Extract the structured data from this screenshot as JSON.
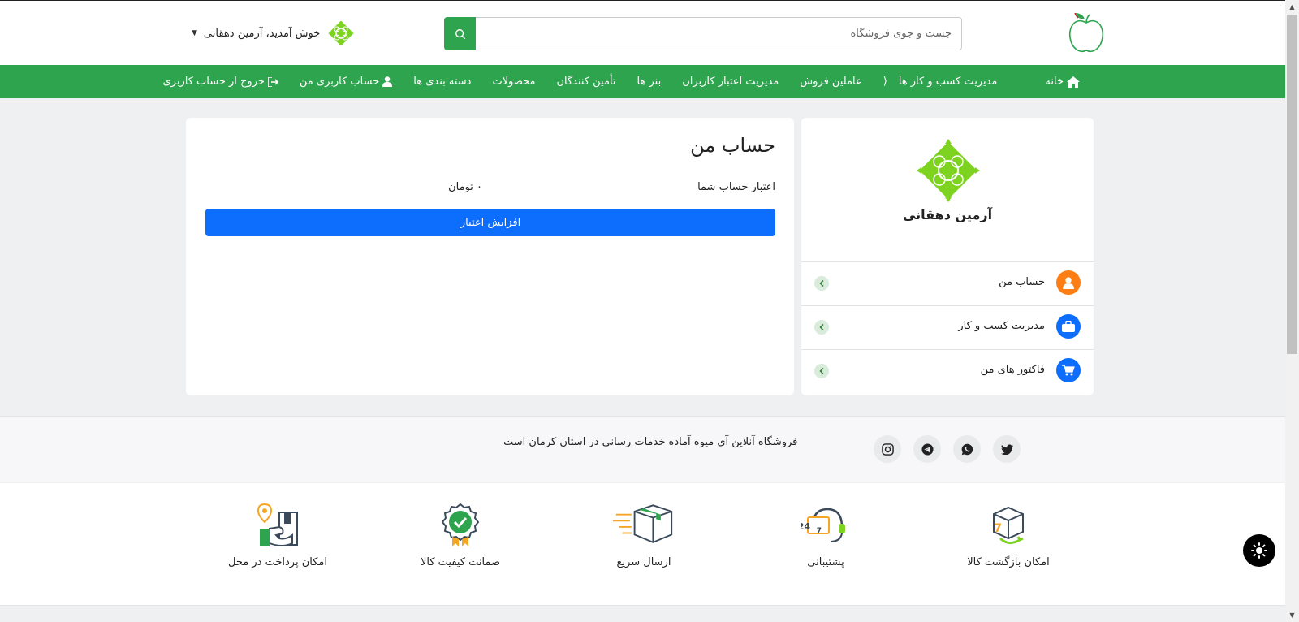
{
  "header": {
    "search_placeholder": "جست و جوی فروشگاه",
    "welcome_text": "خوش آمدید، آرمین دهقانی"
  },
  "nav": {
    "items": [
      {
        "label": "خانه",
        "icon": "home-icon"
      },
      {
        "label": "مدیریت کسب و کار ها",
        "icon": "chevron-down-icon"
      },
      {
        "label": "عاملین فروش"
      },
      {
        "label": "مدیریت اعتبار کاربران"
      },
      {
        "label": "بنر ها"
      },
      {
        "label": "تأمین کنندگان"
      },
      {
        "label": "محصولات"
      },
      {
        "label": "دسته بندی ها"
      },
      {
        "label": "حساب کاربری من",
        "icon": "user-icon"
      },
      {
        "label": "خروج از حساب کاربری",
        "icon": "logout-icon"
      }
    ]
  },
  "sidebar": {
    "user_name": "آرمین دهقانی",
    "menu": [
      {
        "label": "حساب من",
        "icon": "user-icon",
        "color": "#fd7e14"
      },
      {
        "label": "مدیریت کسب و کار",
        "icon": "briefcase-icon",
        "color": "#0d6efd"
      },
      {
        "label": "فاکتور های من",
        "icon": "cart-icon",
        "color": "#0d6efd"
      }
    ]
  },
  "account": {
    "title": "حساب من",
    "credit_label": "اعتبار حساب شما",
    "credit_value": "۰ تومان",
    "increase_button": "افزایش اعتبار"
  },
  "footer": {
    "tagline": "فروشگاه آنلاین آی میوه آماده خدمات رسانی در استان کرمان است",
    "socials": [
      "twitter-icon",
      "whatsapp-icon",
      "telegram-icon",
      "instagram-icon"
    ],
    "features": [
      {
        "label": "امکان بازگشت کالا",
        "icon": "return-box-icon"
      },
      {
        "label": "پشتیبانی",
        "icon": "support-24-7-icon"
      },
      {
        "label": "ارسال سریع",
        "icon": "fast-delivery-icon"
      },
      {
        "label": "ضمانت کیفیت کالا",
        "icon": "quality-badge-icon"
      },
      {
        "label": "امکان پرداخت در محل",
        "icon": "pay-on-delivery-icon"
      }
    ]
  },
  "colors": {
    "brand_green": "#2ea44f",
    "primary_blue": "#0d6efd",
    "accent_orange": "#fd7e14"
  }
}
